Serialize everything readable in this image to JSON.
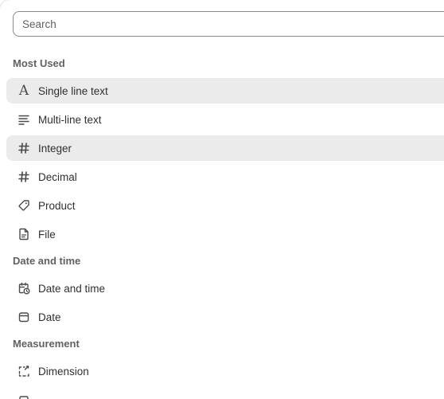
{
  "search": {
    "placeholder": "Search",
    "value": ""
  },
  "sections": [
    {
      "title": "Most Used",
      "items": [
        {
          "label": "Single line text",
          "icon": "text-type-icon",
          "highlighted": true
        },
        {
          "label": "Multi-line text",
          "icon": "text-align-left-icon",
          "highlighted": false
        },
        {
          "label": "Integer",
          "icon": "hashtag-icon",
          "highlighted": true
        },
        {
          "label": "Decimal",
          "icon": "hashtag-icon",
          "highlighted": false
        },
        {
          "label": "Product",
          "icon": "product-tag-icon",
          "highlighted": false
        },
        {
          "label": "File",
          "icon": "file-icon",
          "highlighted": false
        }
      ]
    },
    {
      "title": "Date and time",
      "items": [
        {
          "label": "Date and time",
          "icon": "calendar-clock-icon",
          "highlighted": false
        },
        {
          "label": "Date",
          "icon": "calendar-icon",
          "highlighted": false
        }
      ]
    },
    {
      "title": "Measurement",
      "items": [
        {
          "label": "Dimension",
          "icon": "dimension-icon",
          "highlighted": false
        }
      ]
    }
  ],
  "colors": {
    "highlight": "#ebebeb",
    "text": "#303030",
    "section_title": "#616161",
    "border": "#8a8a8a"
  }
}
